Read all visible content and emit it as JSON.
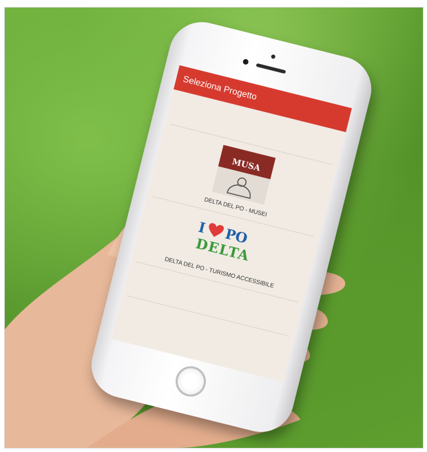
{
  "app": {
    "title": "Seleziona Progetto"
  },
  "projects": [
    {
      "label": "DELTA DEL PO -  MUSEI",
      "logo_text": "MUSA",
      "logo_icon": "musei-logo-icon"
    },
    {
      "label": "DELTA DEL PO - TURISMO ACCESSIBILE",
      "logo_line1": "I",
      "logo_line1b": "PO",
      "logo_line2": "DELTA",
      "logo_icon": "heart-icon"
    }
  ],
  "colors": {
    "appbar": "#d63a2e",
    "screen_bg": "#f1ebe4",
    "grass": "#5f9f2f",
    "musei_brand": "#8a2a24",
    "po_blue": "#1f5fa8",
    "po_green": "#3a9a3a",
    "heart_red": "#e03a3a"
  }
}
